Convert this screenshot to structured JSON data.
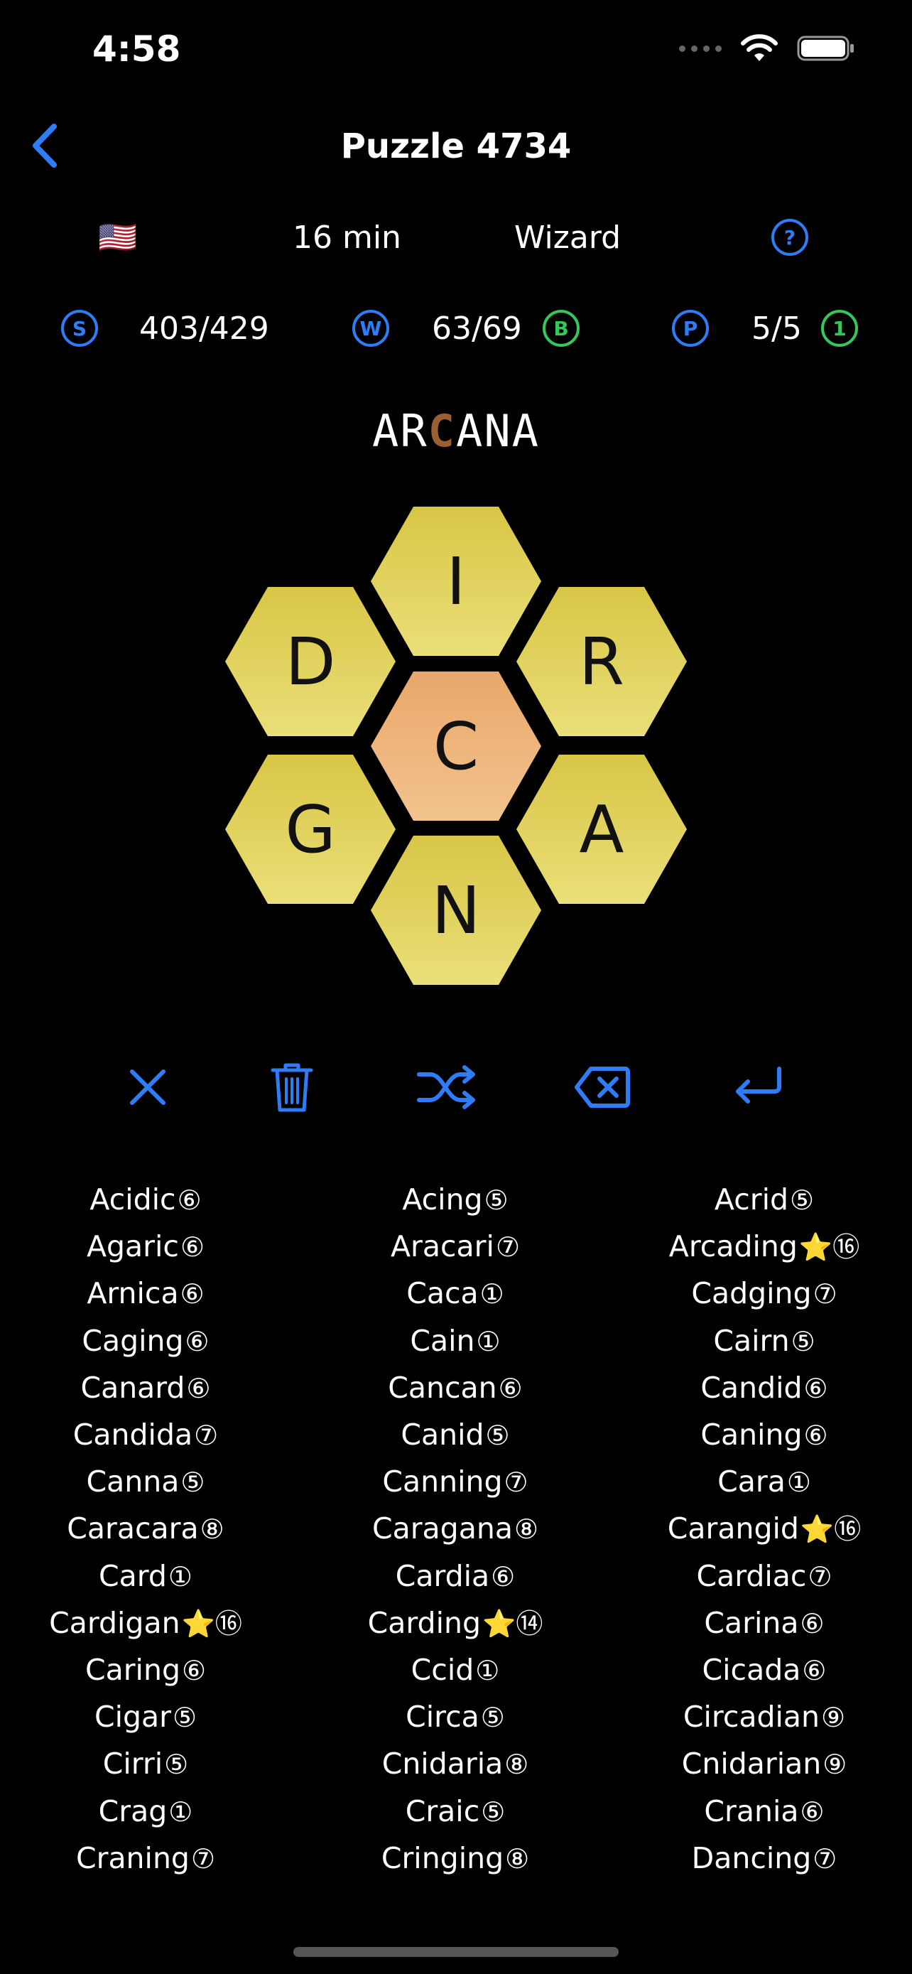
{
  "status": {
    "time": "4:58"
  },
  "nav": {
    "title": "Puzzle 4734"
  },
  "info": {
    "flag": "🇺🇸",
    "time": "16 min",
    "rank": "Wizard",
    "help": "?"
  },
  "stats": {
    "score_badge": "S",
    "score": "403/429",
    "words_badge": "W",
    "words": "63/69",
    "words_extra": "B",
    "pangrams_badge": "P",
    "pangrams": "5/5",
    "pangrams_extra": "1"
  },
  "current_word": {
    "before": "AR",
    "center": "C",
    "after": "ANA"
  },
  "hive": {
    "center": "C",
    "top": "I",
    "top_left": "D",
    "top_right": "R",
    "bottom_left": "G",
    "bottom_right": "A",
    "bottom": "N"
  },
  "toolbar": [
    "close-icon",
    "trash-icon",
    "shuffle-icon",
    "backspace-icon",
    "enter-icon"
  ],
  "words": [
    [
      "Acidic",
      "⑥"
    ],
    [
      "Acing",
      "⑤"
    ],
    [
      "Acrid",
      "⑤"
    ],
    [
      "Agaric",
      "⑥"
    ],
    [
      "Aracari",
      "⑦"
    ],
    [
      "Arcading",
      "⭐⑯"
    ],
    [
      "Arnica",
      "⑥"
    ],
    [
      "Caca",
      "①"
    ],
    [
      "Cadging",
      "⑦"
    ],
    [
      "Caging",
      "⑥"
    ],
    [
      "Cain",
      "①"
    ],
    [
      "Cairn",
      "⑤"
    ],
    [
      "Canard",
      "⑥"
    ],
    [
      "Cancan",
      "⑥"
    ],
    [
      "Candid",
      "⑥"
    ],
    [
      "Candida",
      "⑦"
    ],
    [
      "Canid",
      "⑤"
    ],
    [
      "Caning",
      "⑥"
    ],
    [
      "Canna",
      "⑤"
    ],
    [
      "Canning",
      "⑦"
    ],
    [
      "Cara",
      "①"
    ],
    [
      "Caracara",
      "⑧"
    ],
    [
      "Caragana",
      "⑧"
    ],
    [
      "Carangid",
      "⭐⑯"
    ],
    [
      "Card",
      "①"
    ],
    [
      "Cardia",
      "⑥"
    ],
    [
      "Cardiac",
      "⑦"
    ],
    [
      "Cardigan",
      "⭐⑯"
    ],
    [
      "Carding",
      "⭐⑭"
    ],
    [
      "Carina",
      "⑥"
    ],
    [
      "Caring",
      "⑥"
    ],
    [
      "Ccid",
      "①"
    ],
    [
      "Cicada",
      "⑥"
    ],
    [
      "Cigar",
      "⑤"
    ],
    [
      "Circa",
      "⑤"
    ],
    [
      "Circadian",
      "⑨"
    ],
    [
      "Cirri",
      "⑤"
    ],
    [
      "Cnidaria",
      "⑧"
    ],
    [
      "Cnidarian",
      "⑨"
    ],
    [
      "Crag",
      "①"
    ],
    [
      "Craic",
      "⑤"
    ],
    [
      "Crania",
      "⑥"
    ],
    [
      "Craning",
      "⑦"
    ],
    [
      "Cringing",
      "⑧"
    ],
    [
      "Dancing",
      "⑦"
    ]
  ],
  "colors": {
    "accent": "#2f7df6",
    "green": "#34c759",
    "hex_outer": "#e3d35c",
    "hex_center": "#eeb57e",
    "center_letter": "#9b5f32"
  }
}
